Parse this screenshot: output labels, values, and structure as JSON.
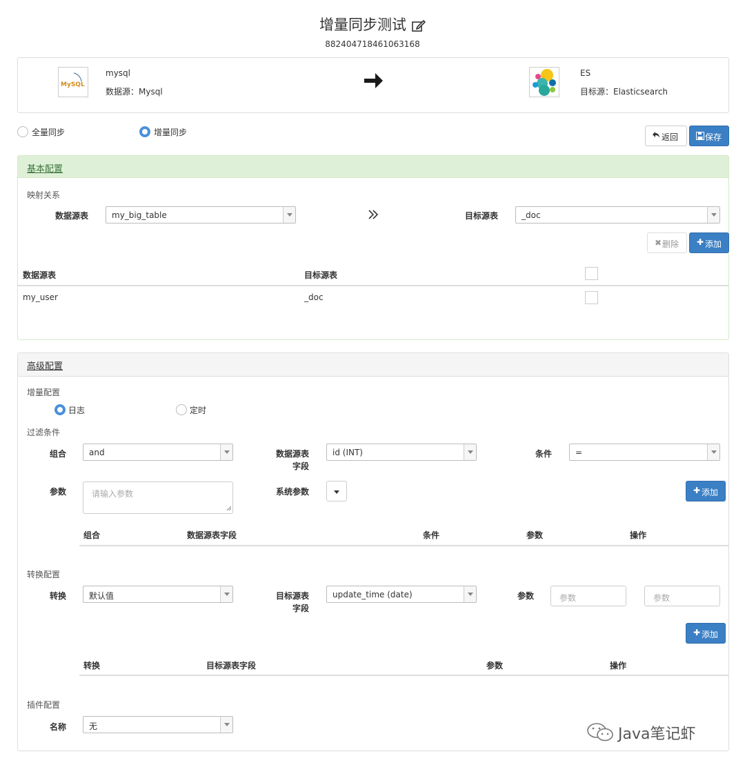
{
  "header": {
    "title": "增量同步测试",
    "id": "882404718461063168"
  },
  "source": {
    "name": "mysql",
    "type_label": "数据源：Mysql",
    "logo_text": "MySQL"
  },
  "target": {
    "name": "ES",
    "type_label": "目标源：Elasticsearch"
  },
  "sync_mode": {
    "options": [
      "全量同步",
      "增量同步"
    ],
    "selected": "增量同步"
  },
  "actions": {
    "back": "返回",
    "save": "保存"
  },
  "basic": {
    "title": "基本配置",
    "mapping_label": "映射关系",
    "source_table_label": "数据源表",
    "source_table_value": "my_big_table",
    "target_table_label": "目标源表",
    "target_table_value": "_doc",
    "delete_button": "删除",
    "add_button": "添加",
    "table": {
      "headers": [
        "数据源表",
        "目标源表"
      ],
      "rows": [
        {
          "source": "my_user",
          "target": "_doc"
        }
      ]
    }
  },
  "advanced": {
    "title": "高级配置",
    "incremental": {
      "label": "增量配置",
      "options": [
        "日志",
        "定时"
      ],
      "selected": "日志"
    },
    "filter": {
      "label": "过滤条件",
      "group_label": "组合",
      "group_value": "and",
      "field_label_1": "数据源表",
      "field_label_2": "字段",
      "field_value": "id (INT)",
      "cond_label": "条件",
      "cond_value": "=",
      "param_label": "参数",
      "param_placeholder": "请输入参数",
      "sys_param_label": "系统参数",
      "add_button": "添加",
      "headers": [
        "组合",
        "数据源表字段",
        "条件",
        "参数",
        "操作"
      ]
    },
    "convert": {
      "label": "转换配置",
      "convert_label": "转换",
      "convert_value": "默认值",
      "field_label_1": "目标源表",
      "field_label_2": "字段",
      "field_value": "update_time (date)",
      "param_label": "参数",
      "param_placeholder_1": "参数",
      "param_placeholder_2": "参数",
      "add_button": "添加",
      "headers": [
        "转换",
        "目标源表字段",
        "参数",
        "操作"
      ]
    },
    "plugin": {
      "label": "插件配置",
      "name_label": "名称",
      "name_value": "无"
    }
  },
  "watermark": "Java笔记虾"
}
